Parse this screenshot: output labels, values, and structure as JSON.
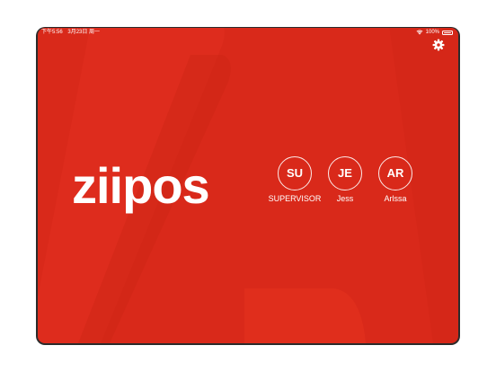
{
  "status_bar": {
    "time": "下午5:56",
    "date": "3月23日 周一",
    "battery": "100%"
  },
  "brand": {
    "logo_text": "ziipos",
    "background_color": "#d9291a"
  },
  "icons": {
    "settings": "gear-icon",
    "wifi": "wifi-icon",
    "battery": "battery-icon"
  },
  "users": [
    {
      "initials": "SU",
      "name": "SUPERVISOR"
    },
    {
      "initials": "JE",
      "name": "Jess"
    },
    {
      "initials": "AR",
      "name": "Arlssa"
    }
  ]
}
